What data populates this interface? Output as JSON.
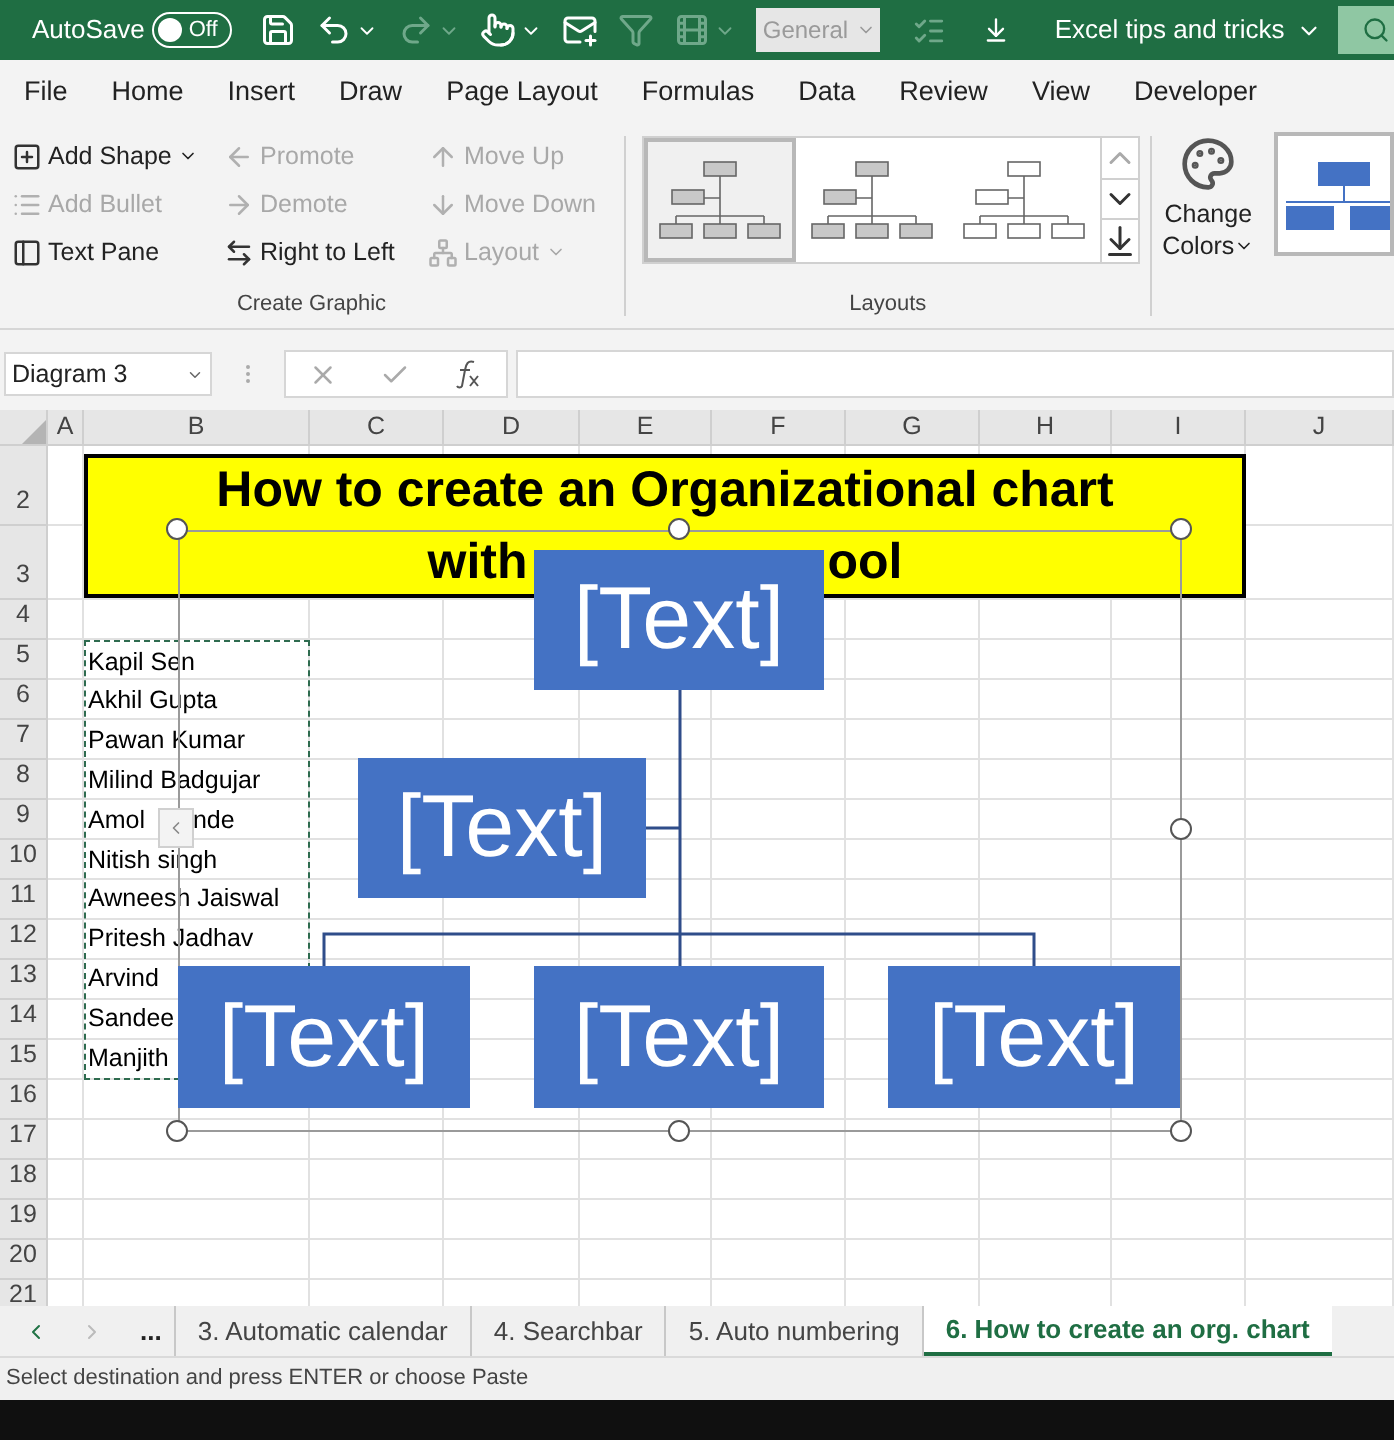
{
  "title_bar": {
    "autosave_label": "AutoSave",
    "autosave": {
      "on": false,
      "label": "Off"
    },
    "quick_access": [
      {
        "kind": "save",
        "disabled": false,
        "dropdown": false
      },
      {
        "kind": "undo",
        "disabled": false,
        "dropdown": true
      },
      {
        "kind": "redo",
        "disabled": true,
        "dropdown": true
      },
      {
        "kind": "touch",
        "disabled": false,
        "dropdown": true
      },
      {
        "kind": "mail",
        "disabled": false,
        "dropdown": false
      },
      {
        "kind": "filter",
        "disabled": true,
        "dropdown": false
      },
      {
        "kind": "film",
        "disabled": true,
        "dropdown": true
      }
    ],
    "number_format": {
      "value": "General",
      "disabled": true
    },
    "workbook": "Excel tips and tricks"
  },
  "menu_tabs": [
    {
      "label": "File",
      "selected": false
    },
    {
      "label": "Home",
      "selected": false
    },
    {
      "label": "Insert",
      "selected": false
    },
    {
      "label": "Draw",
      "selected": false
    },
    {
      "label": "Page Layout",
      "selected": false
    },
    {
      "label": "Formulas",
      "selected": false
    },
    {
      "label": "Data",
      "selected": false
    },
    {
      "label": "Review",
      "selected": false
    },
    {
      "label": "View",
      "selected": false
    },
    {
      "label": "Developer",
      "selected": false
    }
  ],
  "ribbon": {
    "create_graphic": {
      "label": "Create Graphic",
      "columns": [
        [
          {
            "kind": "add-shape",
            "label": "Add Shape",
            "disabled": false,
            "dropdown": true
          },
          {
            "kind": "add-bullet",
            "label": "Add Bullet",
            "disabled": true,
            "dropdown": false
          },
          {
            "kind": "text-pane",
            "label": "Text Pane",
            "disabled": false,
            "dropdown": false
          }
        ],
        [
          {
            "kind": "promote",
            "label": "Promote",
            "disabled": true,
            "dropdown": false
          },
          {
            "kind": "demote",
            "label": "Demote",
            "disabled": true,
            "dropdown": false
          },
          {
            "kind": "right-to-left",
            "label": "Right to Left",
            "disabled": false,
            "dropdown": false
          }
        ],
        [
          {
            "kind": "move-up",
            "label": "Move Up",
            "disabled": true,
            "dropdown": false
          },
          {
            "kind": "move-down",
            "label": "Move Down",
            "disabled": true,
            "dropdown": false
          },
          {
            "kind": "layout",
            "label": "Layout",
            "disabled": true,
            "dropdown": true
          }
        ]
      ]
    },
    "layouts": {
      "label": "Layouts",
      "options": [
        {
          "selected": true
        },
        {
          "selected": false
        },
        {
          "selected": false
        }
      ]
    },
    "change_colors": [
      "Change",
      "Colors"
    ]
  },
  "formula_bar": {
    "name_box": "Diagram 3"
  },
  "sheet": {
    "columns": [
      "A",
      "B",
      "C",
      "D",
      "E",
      "F",
      "G",
      "H",
      "I",
      "J"
    ],
    "rows": [
      "2",
      "3",
      "4",
      "5",
      "6",
      "7",
      "8",
      "9",
      "10",
      "11",
      "12",
      "13",
      "14",
      "15",
      "16",
      "17",
      "18",
      "19",
      "20",
      "21"
    ],
    "title": {
      "line1": "How to create an Organizational chart",
      "line2_start": "with",
      "line2_end": "ool"
    },
    "names": [
      {
        "text": "Kapil Sen"
      },
      {
        "text": "Akhil Gupta"
      },
      {
        "text": "Pawan Kumar"
      },
      {
        "text": "Milind Badgujar"
      },
      {
        "text": "Amol",
        "rest": "nde"
      },
      {
        "text": "Nitish singh"
      },
      {
        "text": "Awneesh Jaiswal"
      },
      {
        "text": "Pritesh Jadhav"
      },
      {
        "text": "Arvind"
      },
      {
        "text": "Sandee"
      },
      {
        "text": "Manjith"
      }
    ]
  },
  "diagram": {
    "nodes": [
      {
        "text": "[Text]"
      },
      {
        "text": "[Text]"
      },
      {
        "text": "[Text]"
      },
      {
        "text": "[Text]"
      },
      {
        "text": "[Text]"
      }
    ]
  },
  "sheet_tabs": {
    "more": "...",
    "tabs": [
      {
        "label": "3. Automatic calendar",
        "selected": false
      },
      {
        "label": "4. Searchbar",
        "selected": false
      },
      {
        "label": "5. Auto numbering",
        "selected": false
      },
      {
        "label": "6. How to create an org. chart",
        "selected": true
      }
    ]
  },
  "status_bar": "Select destination and press ENTER or choose Paste"
}
